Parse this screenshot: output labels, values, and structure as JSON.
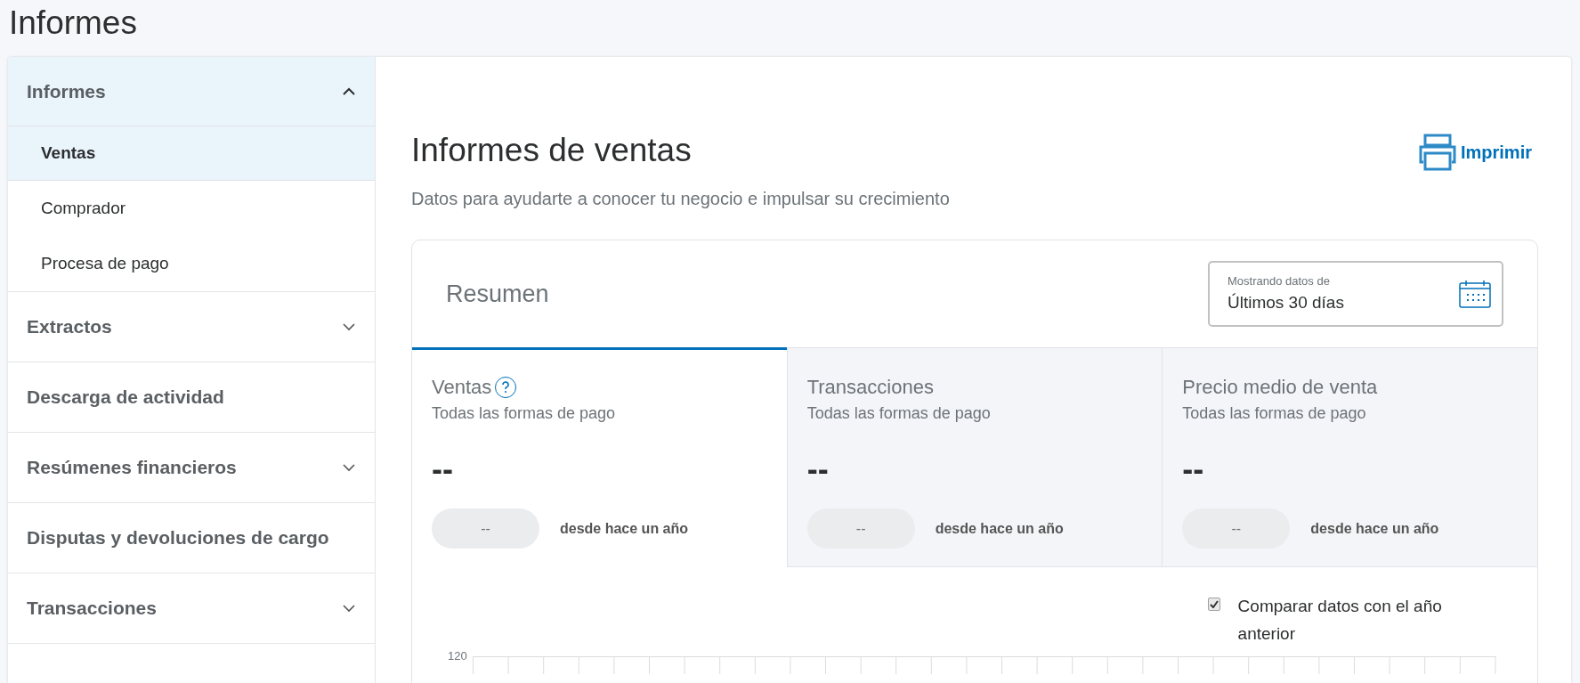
{
  "page_title": "Informes",
  "sidebar": {
    "sections": [
      {
        "kind": "group",
        "label": "Informes",
        "expanded": true,
        "children": [
          {
            "label": "Ventas",
            "selected": true
          },
          {
            "label": "Comprador",
            "selected": false
          },
          {
            "label": "Procesa de pago",
            "selected": false
          }
        ]
      },
      {
        "kind": "group",
        "label": "Extractos",
        "expanded": false
      },
      {
        "kind": "link",
        "label": "Descarga de actividad"
      },
      {
        "kind": "group",
        "label": "Resúmenes financieros",
        "expanded": false
      },
      {
        "kind": "link",
        "label": "Disputas y devoluciones de cargo"
      },
      {
        "kind": "group",
        "label": "Transacciones",
        "expanded": false
      }
    ]
  },
  "main": {
    "title": "Informes de ventas",
    "subtitle": "Datos para ayudarte a conocer tu negocio e impulsar su crecimiento",
    "print_label": "Imprimir",
    "summary": {
      "title": "Resumen",
      "date_field": {
        "label": "Mostrando datos de",
        "value": "Últimos 30 días"
      },
      "tabs": [
        {
          "title": "Ventas",
          "help": true,
          "subtitle": "Todas las formas de pago",
          "value": "--",
          "change": "--",
          "change_caption": "desde hace un año",
          "selected": true
        },
        {
          "title": "Transacciones",
          "help": false,
          "subtitle": "Todas las formas de pago",
          "value": "--",
          "change": "--",
          "change_caption": "desde hace un año",
          "selected": false
        },
        {
          "title": "Precio medio de venta",
          "help": false,
          "subtitle": "Todas las formas de pago",
          "value": "--",
          "change": "--",
          "change_caption": "desde hace un año",
          "selected": false
        }
      ],
      "compare": {
        "label": "Comparar datos con el año anterior",
        "checked": true
      },
      "chart": {
        "y_tick": "120"
      }
    }
  }
}
